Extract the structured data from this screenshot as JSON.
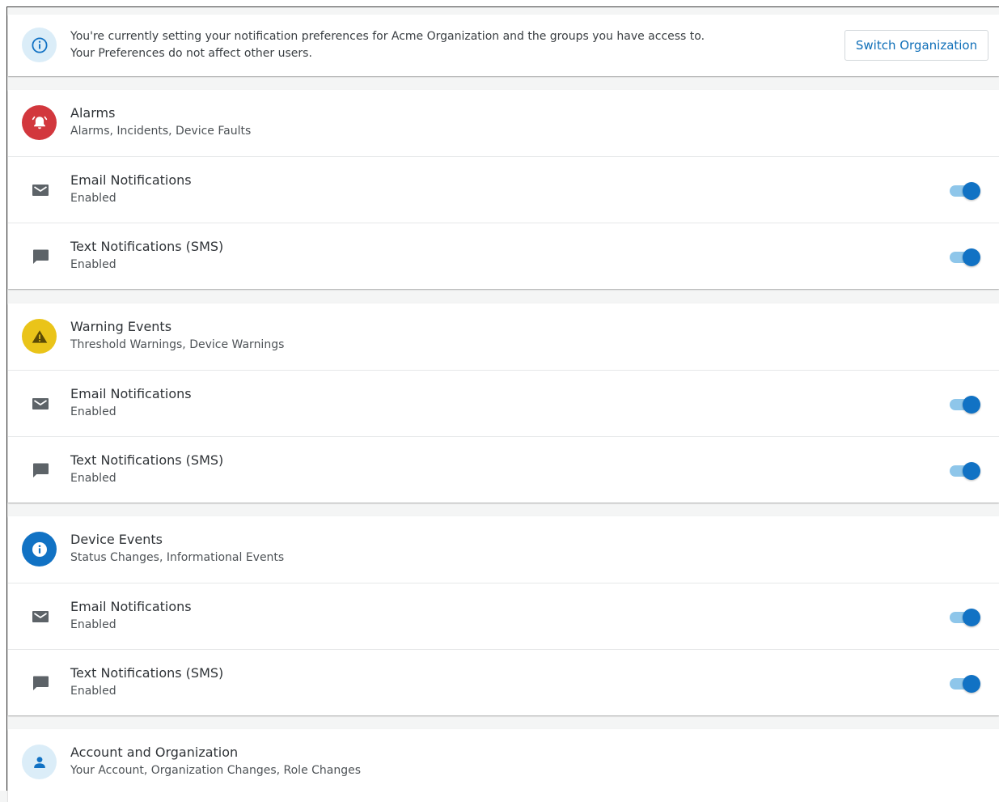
{
  "banner": {
    "line1": "You're currently setting your notification preferences for Acme Organization and the groups you have access to.",
    "line2": "Your Preferences do not affect other users.",
    "button_label": "Switch Organization"
  },
  "sections": [
    {
      "title": "Alarms",
      "subtitle": "Alarms, Incidents, Device Faults",
      "icon": "alarm-bell-icon",
      "icon_color": "#d2373d",
      "rows": [
        {
          "title": "Email Notifications",
          "status": "Enabled",
          "icon": "email-icon",
          "enabled": true
        },
        {
          "title": "Text Notifications (SMS)",
          "status": "Enabled",
          "icon": "sms-icon",
          "enabled": true
        }
      ]
    },
    {
      "title": "Warning Events",
      "subtitle": "Threshold Warnings, Device Warnings",
      "icon": "warning-triangle-icon",
      "icon_color": "#eac419",
      "rows": [
        {
          "title": "Email Notifications",
          "status": "Enabled",
          "icon": "email-icon",
          "enabled": true
        },
        {
          "title": "Text Notifications (SMS)",
          "status": "Enabled",
          "icon": "sms-icon",
          "enabled": true
        }
      ]
    },
    {
      "title": "Device Events",
      "subtitle": "Status Changes, Informational Events",
      "icon": "info-icon",
      "icon_color": "#1172c4",
      "rows": [
        {
          "title": "Email Notifications",
          "status": "Enabled",
          "icon": "email-icon",
          "enabled": true
        },
        {
          "title": "Text Notifications (SMS)",
          "status": "Enabled",
          "icon": "sms-icon",
          "enabled": true
        }
      ]
    },
    {
      "title": "Account and Organization",
      "subtitle": "Your Account, Organization Changes, Role Changes",
      "icon": "person-icon",
      "icon_color": "#dbedf8"
    }
  ],
  "colors": {
    "accent": "#1172c4",
    "toggle_track": "#8ec6ea",
    "icon_gray": "#5d6368"
  }
}
